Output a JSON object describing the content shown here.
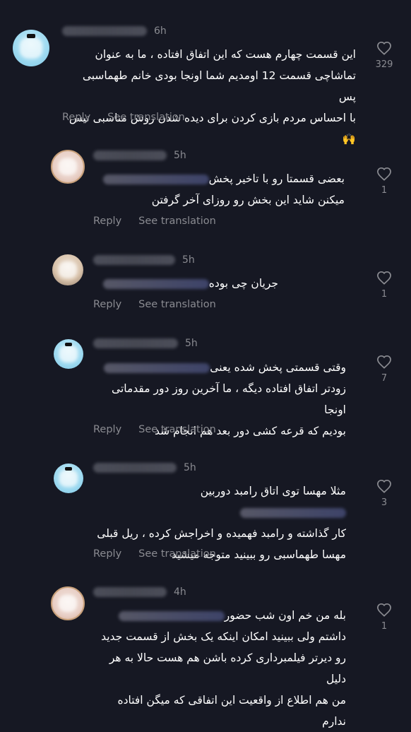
{
  "comments": [
    {
      "time": "6h",
      "text_lines": [
        "این قسمت چهارم هست که این اتفاق افتاده ، ما به عنوان",
        "تماشاچی قسمت 12 اومدیم شما اونجا بودی خانم طهماسبی پس",
        "با احساس مردم بازی کردن برای دیده شدن روش مناسبی نیس🙌"
      ],
      "likes": "329",
      "reply_label": "Reply",
      "translate_label": "See translation"
    },
    {
      "time": "5h",
      "text_lines": [
        "بعضی قسمتا رو با تاخیر پخش",
        "میکنن شاید این بخش رو روزای آخر گرفتن"
      ],
      "likes": "1",
      "reply_label": "Reply",
      "translate_label": "See translation"
    },
    {
      "time": "5h",
      "text_lines": [
        "جریان چی بوده"
      ],
      "likes": "1",
      "reply_label": "Reply",
      "translate_label": "See translation"
    },
    {
      "time": "5h",
      "text_lines": [
        "وقتی قسمتی پخش شده یعنی",
        "زودتر اتفاق افتاده دیگه ، ما آخرین روز دور مقدماتی اونجا",
        "بودیم که قرعه کشی دور بعد هم انجام شد"
      ],
      "likes": "7",
      "reply_label": "Reply",
      "translate_label": "See translation"
    },
    {
      "time": "5h",
      "text_lines": [
        "مثلا مهسا توی اتاق رامبد دوربین",
        "کار گذاشته و رامبد فهمیده و اخراجش کرده ، ریل قبلی",
        "مهسا طهماسبی رو ببینید متوجه میشید"
      ],
      "likes": "3",
      "reply_label": "Reply",
      "translate_label": "See translation"
    },
    {
      "time": "4h",
      "text_lines": [
        "بله من خم اون شب حضور",
        "داشتم ولی ببینید امکان اینکه یک بخش از قسمت جدید",
        "رو دیرتر فیلمبرداری کرده باشن هم هست حالا به هر دلیل",
        "من هم اطلاع از واقعیت این اتفاقی که میگن افتاده ندارم"
      ],
      "likes": "1"
    }
  ]
}
